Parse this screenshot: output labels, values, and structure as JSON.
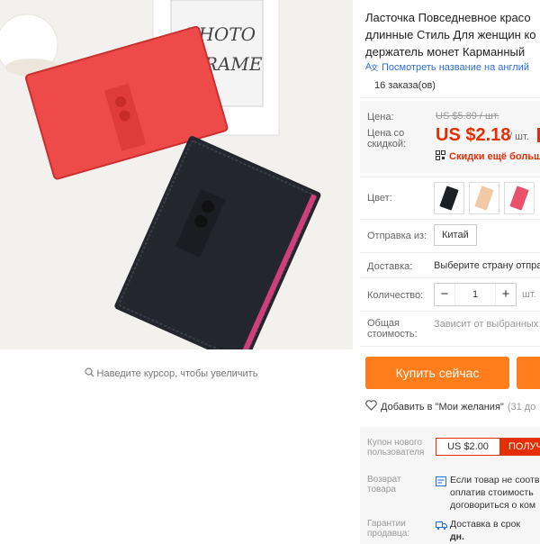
{
  "gallery": {
    "zoom_hint": "Наведите курсор, чтобы увеличить",
    "frame_text_line1": "PHOTO",
    "frame_text_line2": "FRAME"
  },
  "product": {
    "title_line1": "Ласточка Повседневное красо",
    "title_line2": "длинные Стиль Для женщин ко",
    "title_line3": "держатель монет Карманный",
    "translate_link": "Посмотреть название на англий",
    "orders": "16 заказа(ов)"
  },
  "price": {
    "price_label": "Цена:",
    "old_price": "US $5.89 / шт.",
    "discount_label_line1": "Цена со",
    "discount_label_line2": "скидкой:",
    "new_price": "US $2.18",
    "per_unit": "/ шт.",
    "more_discounts": "Скидки ещё больше"
  },
  "options": {
    "color_label": "Цвет:",
    "shipping_from_label": "Отправка из:",
    "shipping_from_value": "Китай",
    "delivery_label": "Доставка:",
    "delivery_value": "Выберите страну отпра",
    "quantity_label": "Количество:",
    "quantity_value": "1",
    "quantity_minus": "−",
    "quantity_plus": "+",
    "quantity_unit": "шт.",
    "total_label_line1": "Общая",
    "total_label_line2": "стоимость:",
    "total_value": "Зависит от выбранных",
    "swatch_colors": [
      "#1c1f24",
      "#f2c9a5",
      "#e9506a"
    ]
  },
  "actions": {
    "buy_now": "Купить сейчас",
    "wishlist": "Добавить в \"Мои желания\"",
    "wishlist_count": "(31 до"
  },
  "services": {
    "coupon_label_line1": "Купон нового",
    "coupon_label_line2": "пользователя",
    "coupon_value": "US $2.00",
    "coupon_button": "ПОЛУЧ",
    "return_label_line1": "Возврат",
    "return_label_line2": "товара",
    "return_text_line1": "Если товар не соотв",
    "return_text_line2": "оплатив стоимость",
    "return_text_line3": "договориться о ком",
    "guarantee_label_line1": "Гарантии",
    "guarantee_label_line2": "продавца:",
    "guarantee_text_line1": "Доставка в срок",
    "guarantee_text_line2": "дн."
  },
  "colors": {
    "accent_orange": "#ff7d1a",
    "price_red": "#e62e04",
    "link_blue": "#2a6fd6"
  }
}
